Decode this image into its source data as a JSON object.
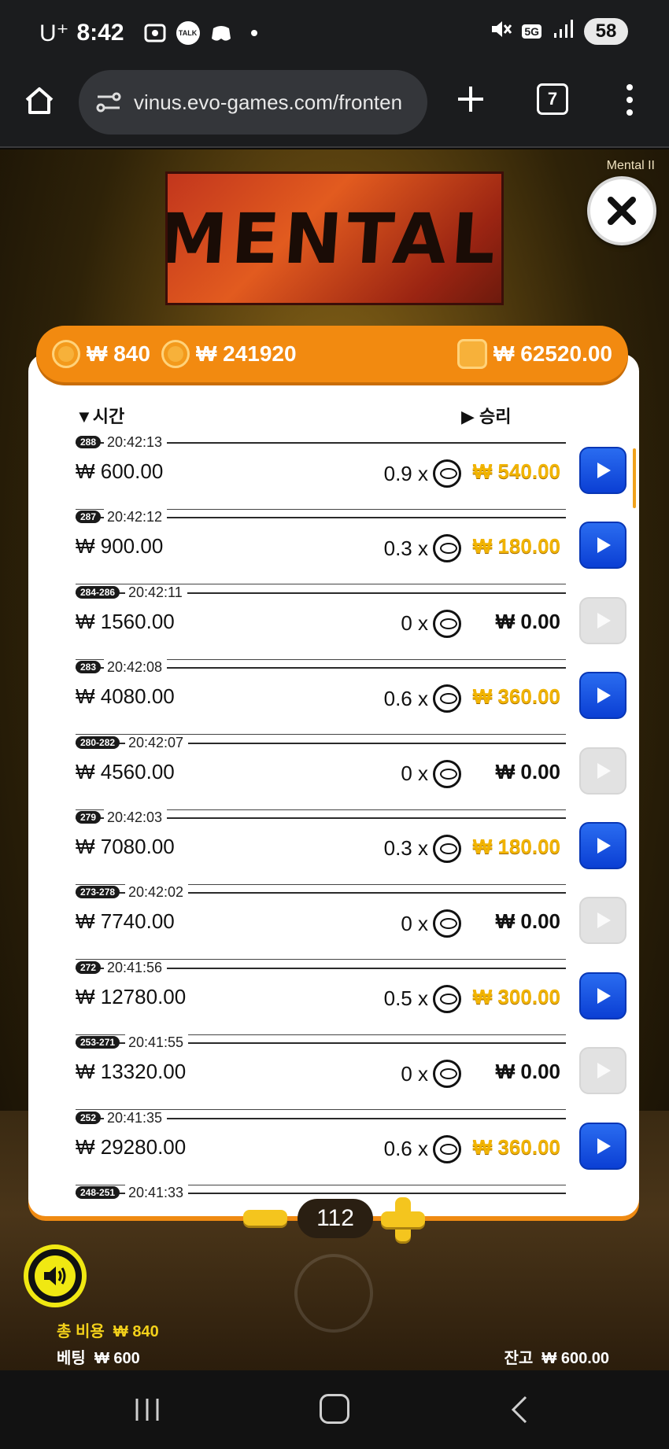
{
  "status_bar": {
    "carrier": "U⁺",
    "time": "8:42",
    "talk_badge": "TALK",
    "network": "5G",
    "battery": "58"
  },
  "browser": {
    "url": "vinus.evo-games.com/fronten",
    "tab_count": "7"
  },
  "game": {
    "title_label": "Mental II",
    "logo_text": "MENTAL",
    "balance_bar": {
      "coin_value": "₩ 840",
      "coin_total": "₩ 241920",
      "wallet": "₩ 62520.00"
    },
    "history_header": {
      "time_label": "▼시간",
      "win_label": "▶ 승리"
    },
    "rows": [
      {
        "id": "288",
        "time": "20:42:13",
        "bet": "₩ 600.00",
        "mult": "0.9 x",
        "win": "₩ 540.00",
        "win_style": "gold",
        "replay": true
      },
      {
        "id": "287",
        "time": "20:42:12",
        "bet": "₩ 900.00",
        "mult": "0.3 x",
        "win": "₩ 180.00",
        "win_style": "gold",
        "replay": true
      },
      {
        "id": "284-286",
        "time": "20:42:11",
        "bet": "₩ 1560.00",
        "mult": "0 x",
        "win": "₩ 0.00",
        "win_style": "black",
        "replay": false
      },
      {
        "id": "283",
        "time": "20:42:08",
        "bet": "₩ 4080.00",
        "mult": "0.6 x",
        "win": "₩ 360.00",
        "win_style": "gold",
        "replay": true
      },
      {
        "id": "280-282",
        "time": "20:42:07",
        "bet": "₩ 4560.00",
        "mult": "0 x",
        "win": "₩ 0.00",
        "win_style": "black",
        "replay": false
      },
      {
        "id": "279",
        "time": "20:42:03",
        "bet": "₩ 7080.00",
        "mult": "0.3 x",
        "win": "₩ 180.00",
        "win_style": "gold",
        "replay": true
      },
      {
        "id": "273-278",
        "time": "20:42:02",
        "bet": "₩ 7740.00",
        "mult": "0 x",
        "win": "₩ 0.00",
        "win_style": "black",
        "replay": false
      },
      {
        "id": "272",
        "time": "20:41:56",
        "bet": "₩ 12780.00",
        "mult": "0.5 x",
        "win": "₩ 300.00",
        "win_style": "gold",
        "replay": true
      },
      {
        "id": "253-271",
        "time": "20:41:55",
        "bet": "₩ 13320.00",
        "mult": "0 x",
        "win": "₩ 0.00",
        "win_style": "black",
        "replay": false
      },
      {
        "id": "252",
        "time": "20:41:35",
        "bet": "₩ 29280.00",
        "mult": "0.6 x",
        "win": "₩ 360.00",
        "win_style": "gold",
        "replay": true
      },
      {
        "id": "248-251",
        "time": "20:41:33",
        "bet": "",
        "mult": "",
        "win": "",
        "win_style": "black",
        "replay": false
      }
    ],
    "stepper_value": "112",
    "total_cost_label": "총 비용",
    "total_cost_value": "₩ 840",
    "bet_label": "베팅",
    "bet_value": "₩ 600",
    "balance_label": "잔고",
    "balance_value": "₩ 600.00"
  },
  "colors": {
    "accent_orange": "#f28a10",
    "win_gold": "#f2b400",
    "play_blue": "#1a55e6",
    "sound_yellow": "#f0e812"
  }
}
